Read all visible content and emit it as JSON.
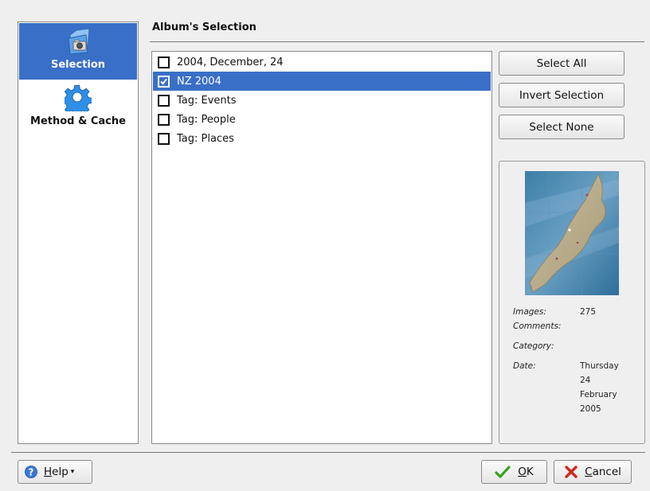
{
  "sidebar": {
    "items": [
      {
        "label": "Selection",
        "active": true,
        "icon": "camera-folder-icon"
      },
      {
        "label": "Method & Cache",
        "active": false,
        "icon": "gear-icon"
      }
    ]
  },
  "header": {
    "title": "Album's Selection"
  },
  "albums": [
    {
      "label": "2004, December, 24",
      "checked": false,
      "selected": false
    },
    {
      "label": "NZ 2004",
      "checked": true,
      "selected": true
    },
    {
      "label": "Tag: Events",
      "checked": false,
      "selected": false
    },
    {
      "label": "Tag: People",
      "checked": false,
      "selected": false
    },
    {
      "label": "Tag: Places",
      "checked": false,
      "selected": false
    }
  ],
  "buttons": {
    "select_all": "Select All",
    "invert_selection": "Invert Selection",
    "select_none": "Select None"
  },
  "info": {
    "images_label": "Images:",
    "images_value": "275",
    "comments_label": "Comments:",
    "comments_value": "",
    "category_label": "Category:",
    "category_value": "",
    "date_label": "Date:",
    "date_value": [
      "Thursday",
      "24",
      "February",
      "2005"
    ]
  },
  "footer": {
    "help_prefix": "",
    "help_mnemonic": "H",
    "help_rest": "elp",
    "ok_mnemonic": "O",
    "ok_rest": "K",
    "cancel_mnemonic": "C",
    "cancel_rest": "ancel"
  },
  "colors": {
    "selection": "#3a6fc8",
    "ok_icon": "#3aa020",
    "cancel_icon": "#d0281e",
    "help_icon": "#3a78d6"
  }
}
